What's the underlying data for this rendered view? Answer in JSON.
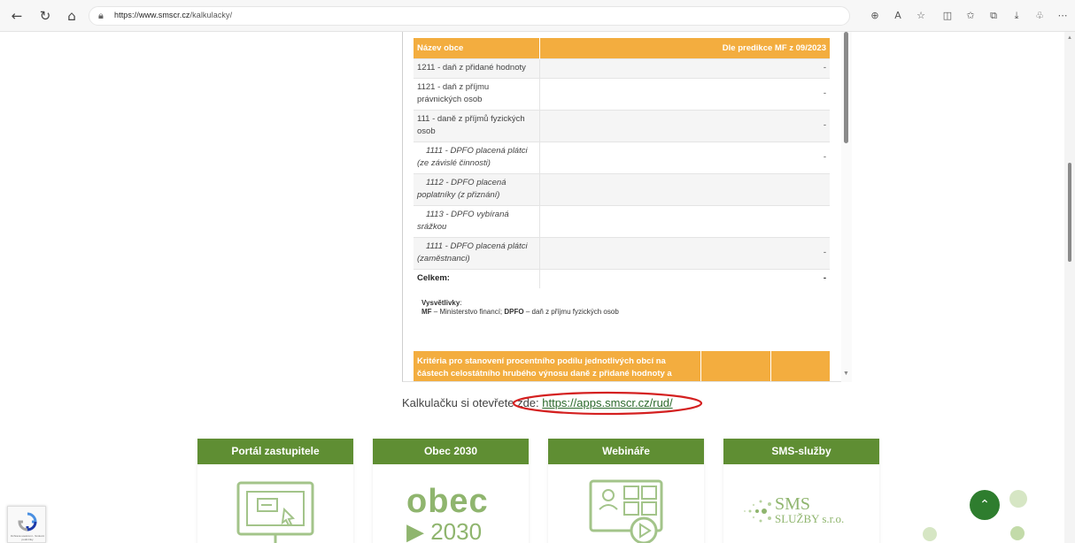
{
  "browser": {
    "url_domain": "https://www.smscr.cz",
    "url_path": "/kalkulacky/",
    "icons": [
      "back-icon",
      "reload-icon",
      "home-icon",
      "lock-icon",
      "zoom-icon",
      "read-aloud-icon",
      "favorite-icon",
      "split-screen-icon",
      "favorites-icon",
      "collections-icon",
      "downloads-icon",
      "extensions-icon",
      "more-icon"
    ]
  },
  "table": {
    "header_left": "Název obce",
    "header_right": "Dle predikce MF z 09/2023",
    "rows": [
      {
        "label": "1211 - daň z přidané hodnoty",
        "value": "-",
        "italic": false
      },
      {
        "label": "1121 - daň z příjmu právnických osob",
        "value": "-",
        "italic": false
      },
      {
        "label": "111 - daně z příjmů fyzických osob",
        "value": "-",
        "italic": false
      },
      {
        "label": "1111 - DPFO placená plátci (ze závislé činnosti)",
        "value": "-",
        "italic": true
      },
      {
        "label": "1112 - DPFO placená poplatníky (z přiznání)",
        "value": "",
        "italic": true
      },
      {
        "label": "1113 - DPFO vybíraná srážkou",
        "value": "",
        "italic": true
      },
      {
        "label": "1111 - DPFO placená plátci (zaměstnanci)",
        "value": "-",
        "italic": true
      }
    ],
    "total_label": "Celkem:",
    "total_value": "-"
  },
  "legend": {
    "title": "Vysvětlivky",
    "mf_abbr": "MF",
    "mf_text": " – Ministerstvo financí;  ",
    "dpfo_abbr": "DPFO",
    "dpfo_text": " – daň z příjmu fyzických osob"
  },
  "criteria_header": "Kritéria pro stanovení procentního podílu jednotlivých obcí na částech celostátního hrubého výnosu daně z přidané hodnoty a",
  "link_line": {
    "prefix": "Kalkulačku si otevřete zde: ",
    "url": "https://apps.smscr.cz/rud/"
  },
  "cards": [
    {
      "title": "Portál zastupitele",
      "icon": "monitor-cursor-icon"
    },
    {
      "title": "Obec 2030",
      "icon": "obec-2030-logo",
      "logo_top": "obec",
      "logo_bottom": "2030"
    },
    {
      "title": "Webináře",
      "icon": "webinar-icon"
    },
    {
      "title": "SMS-služby",
      "icon": "sms-sluzby-logo",
      "logo_top": "SMS",
      "logo_bottom": "SLUŽBY s.r.o."
    }
  ],
  "recaptcha": {
    "text": "Ochrana soukromí - Smluvní podmínky"
  },
  "colors": {
    "orange": "#f3ad3f",
    "green": "#5f8e33",
    "dark_green": "#2e7d2e",
    "link": "#2d6a2d"
  }
}
